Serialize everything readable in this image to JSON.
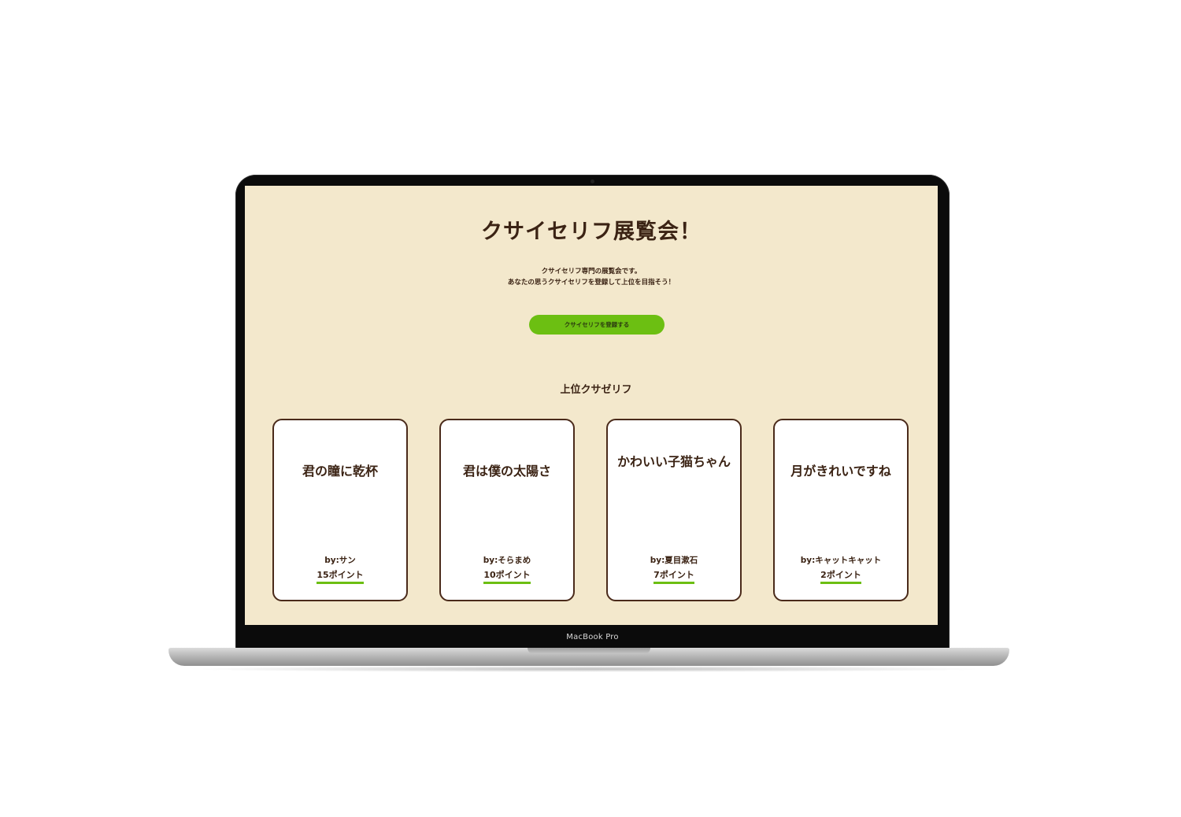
{
  "device": {
    "label": "MacBook Pro"
  },
  "site": {
    "title": "クサイセリフ展覧会！",
    "description": [
      "クサイセリフ専門の展覧会です。",
      "あなたの思うクサイセリフを登録して上位を目指そう！"
    ],
    "register_button": "クサイセリフを登録する",
    "section_title": "上位クサゼリフ",
    "accent_color": "#6cbf12",
    "background_color": "#f3e8cc",
    "text_color": "#3b2314"
  },
  "cards": [
    {
      "quote": "君の瞳に乾杯",
      "author": "by:サン",
      "points": "15ポイント"
    },
    {
      "quote": "君は僕の太陽さ",
      "author": "by:そらまめ",
      "points": "10ポイント"
    },
    {
      "quote": "かわいい子猫ちゃん",
      "author": "by:夏目漱石",
      "points": "7ポイント"
    },
    {
      "quote": "月がきれいですね",
      "author": "by:キャットキャット",
      "points": "2ポイント"
    }
  ]
}
